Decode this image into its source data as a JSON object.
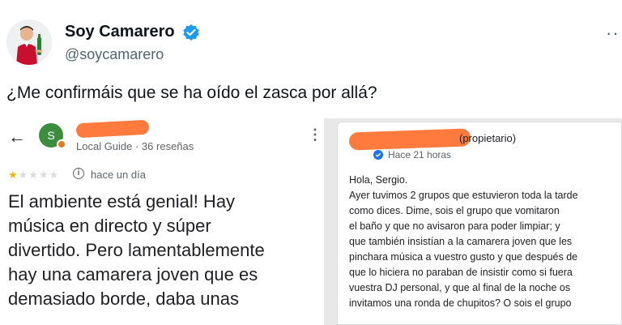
{
  "tweet": {
    "author_name": "Soy Camarero",
    "author_handle": "@soycamarero",
    "more_label": "··",
    "text": "¿Me confirmáis que se ha oído el zasca por allá?"
  },
  "review": {
    "back_glyph": "←",
    "avatar_letter": "S",
    "meta": "Local Guide · 36 reseñas",
    "menu_glyph": "⋮",
    "rating": 1,
    "rating_max": 5,
    "date": "hace un día",
    "lines": [
      "El ambiente está genial! Hay",
      "música en directo y súper",
      "divertido. Pero lamentablemente",
      "hay una camarera joven que es",
      "demasiado borde, daba unas"
    ]
  },
  "reply": {
    "role": "(propietario)",
    "time": "Hace 21 horas",
    "lines": [
      "Hola, Sergio.",
      "Ayer tuvimos 2 grupos que estuvieron toda la tarde",
      "como dices. Dime, sois el grupo que vomitaron",
      "el baño y que no avisaron para poder limpiar; y",
      "que también insistían a la camarera joven que les",
      "pinchara música a vuestro gusto y que después de",
      "que lo hiciera no paraban de insistir como si fuera",
      "vuestra DJ personal, y que al final de la noche os",
      "invitamos una ronda de chupitos? O sois el grupo"
    ]
  },
  "colors": {
    "verified": "#1d9bf0",
    "redaction": "#ff7a3d",
    "star": "#f4b400",
    "guide_avatar": "#3c8d3e"
  },
  "icons": [
    "verified-badge-icon",
    "back-arrow-icon",
    "info-icon",
    "kebab-menu-icon",
    "star-icon"
  ]
}
